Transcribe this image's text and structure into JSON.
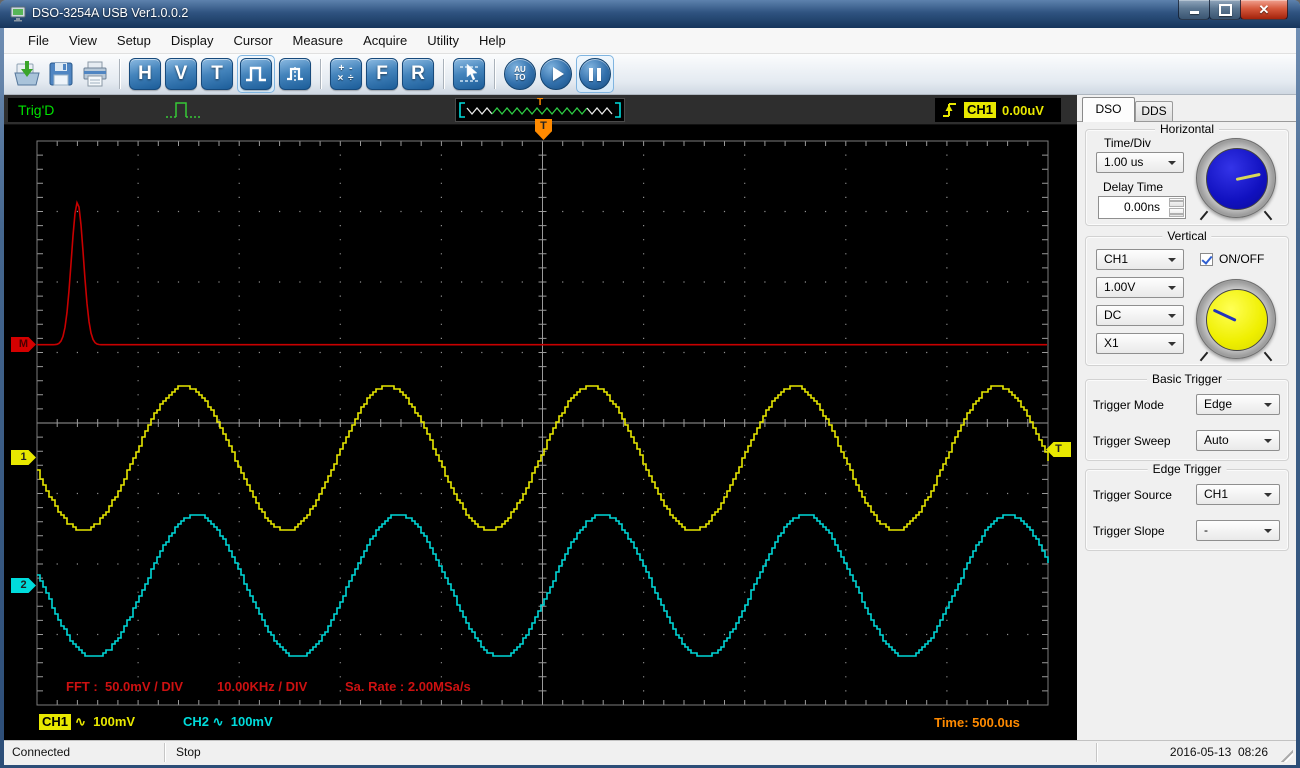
{
  "window": {
    "title": "DSO-3254A USB Ver1.0.0.2"
  },
  "menu": {
    "items": [
      "File",
      "View",
      "Setup",
      "Display",
      "Cursor",
      "Measure",
      "Acquire",
      "Utility",
      "Help"
    ]
  },
  "toolbar": {
    "h": "H",
    "v": "V",
    "t": "T",
    "f": "F",
    "r": "R",
    "math_row1": "+ -",
    "math_row2": "× ÷",
    "auto_line1": "AU",
    "auto_line2": "TO"
  },
  "trigger_bar": {
    "status": "Trig'D",
    "preview_marker": "T",
    "channel_badge": "CH1",
    "trigger_level": "0.00uV"
  },
  "scope": {
    "markers": {
      "fft": "M",
      "ch1": "1",
      "ch2": "2",
      "trigger_top": "T",
      "trigger_right": "T"
    },
    "fft_scale": "FFT :  50.0mV / DIV",
    "fft_freq": "10.00KHz / DIV",
    "sample_rate": "Sa. Rate : 2.00MSa/s",
    "ch1_badge": "CH1",
    "ch1_scale": "∿  100mV",
    "ch2_label": "CH2 ∿  100mV",
    "time_label": "Time: 500.0us"
  },
  "chart_data": {
    "type": "line",
    "title": "Oscilloscope display with FFT trace and two sine channels",
    "grid": {
      "x_divisions": 10,
      "y_divisions": 8
    },
    "series": [
      {
        "name": "FFT",
        "kind": "fft_peak",
        "color": "#c80000",
        "baseline_y_div": 2.89,
        "peak_x_div": 0.4,
        "peak_top_y_div": 0.87,
        "peak_sigma_div": 0.06,
        "scale": "50.0mV / DIV",
        "x_scale": "10.00KHz / DIV"
      },
      {
        "name": "CH1",
        "kind": "sine",
        "color": "#e8e800",
        "center_y_div": 4.5,
        "amplitude_div": 1.02,
        "period_div": 2.01,
        "peak_x_div": 1.45,
        "volts_per_div": "100mV"
      },
      {
        "name": "CH2",
        "kind": "sine",
        "color": "#00d8d8",
        "center_y_div": 6.31,
        "amplitude_div": 1.01,
        "period_div": 2.01,
        "peak_x_div": 1.56,
        "volts_per_div": "100mV"
      }
    ],
    "trigger_level_y_div": 4.38,
    "trigger_x_div": 5.0,
    "time_per_div_display": "500.0us",
    "sample_rate": "2.00MSa/s"
  },
  "panel": {
    "tab_dso": "DSO",
    "tab_dds": "DDS",
    "horizontal": {
      "title": "Horizontal",
      "time_div_label": "Time/Div",
      "time_div_value": "1.00 us",
      "delay_label": "Delay Time",
      "delay_value": "0.00ns"
    },
    "vertical": {
      "title": "Vertical",
      "channel": "CH1",
      "scale": "1.00V",
      "coupling": "DC",
      "probe": "X1",
      "onoff_label": "ON/OFF",
      "onoff_checked": true
    },
    "basic_trigger": {
      "title": "Basic Trigger",
      "mode_label": "Trigger Mode",
      "mode_value": "Edge",
      "sweep_label": "Trigger Sweep",
      "sweep_value": "Auto"
    },
    "edge_trigger": {
      "title": "Edge Trigger",
      "source_label": "Trigger Source",
      "source_value": "CH1",
      "slope_label": "Trigger Slope",
      "slope_value": "-"
    }
  },
  "statusbar": {
    "connection": "Connected",
    "acquisition": "Stop",
    "datetime": "2016-05-13  08:26"
  },
  "colors": {
    "ch1": "#e8e800",
    "ch2": "#00d8d8",
    "fft": "#c80000",
    "trigger_marker": "#ff8a00",
    "trig_status": "#00e000"
  }
}
